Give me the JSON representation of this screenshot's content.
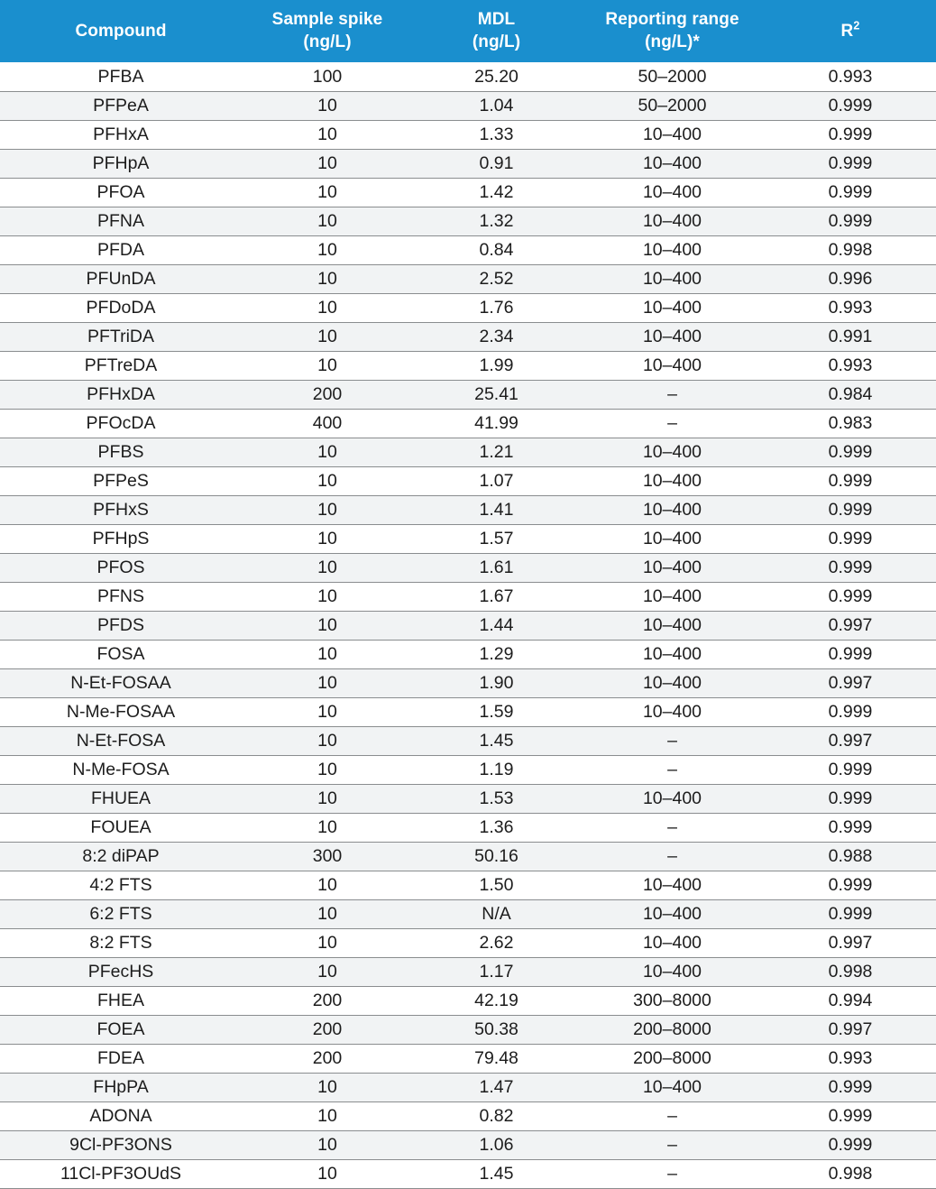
{
  "table": {
    "headers": [
      {
        "line1": "Compound",
        "line2": "",
        "key": "compound"
      },
      {
        "line1": "Sample spike",
        "line2": "(ng/L)",
        "key": "sample_spike"
      },
      {
        "line1": "MDL",
        "line2": "(ng/L)",
        "key": "mdl"
      },
      {
        "line1": "Reporting range",
        "line2": "(ng/L)*",
        "key": "reporting_range"
      },
      {
        "line1": "R",
        "line2": "",
        "sup": "2",
        "key": "r2"
      }
    ],
    "colors": {
      "header_background": "#1a8fce",
      "header_text": "#ffffff",
      "row_stripe": "#f1f3f4",
      "row_base": "#ffffff",
      "rule": "#8a8d8f",
      "body_text": "#1c1c1c"
    },
    "rows": [
      {
        "compound": "PFBA",
        "sample_spike": "100",
        "mdl": "25.20",
        "reporting_range": "50–2000",
        "r2": "0.993"
      },
      {
        "compound": "PFPeA",
        "sample_spike": "10",
        "mdl": "1.04",
        "reporting_range": "50–2000",
        "r2": "0.999"
      },
      {
        "compound": "PFHxA",
        "sample_spike": "10",
        "mdl": "1.33",
        "reporting_range": "10–400",
        "r2": "0.999"
      },
      {
        "compound": "PFHpA",
        "sample_spike": "10",
        "mdl": "0.91",
        "reporting_range": "10–400",
        "r2": "0.999"
      },
      {
        "compound": "PFOA",
        "sample_spike": "10",
        "mdl": "1.42",
        "reporting_range": "10–400",
        "r2": "0.999"
      },
      {
        "compound": "PFNA",
        "sample_spike": "10",
        "mdl": "1.32",
        "reporting_range": "10–400",
        "r2": "0.999"
      },
      {
        "compound": "PFDA",
        "sample_spike": "10",
        "mdl": "0.84",
        "reporting_range": "10–400",
        "r2": "0.998"
      },
      {
        "compound": "PFUnDA",
        "sample_spike": "10",
        "mdl": "2.52",
        "reporting_range": "10–400",
        "r2": "0.996"
      },
      {
        "compound": "PFDoDA",
        "sample_spike": "10",
        "mdl": "1.76",
        "reporting_range": "10–400",
        "r2": "0.993"
      },
      {
        "compound": "PFTriDA",
        "sample_spike": "10",
        "mdl": "2.34",
        "reporting_range": "10–400",
        "r2": "0.991"
      },
      {
        "compound": "PFTreDA",
        "sample_spike": "10",
        "mdl": "1.99",
        "reporting_range": "10–400",
        "r2": "0.993"
      },
      {
        "compound": "PFHxDA",
        "sample_spike": "200",
        "mdl": "25.41",
        "reporting_range": "–",
        "r2": "0.984"
      },
      {
        "compound": "PFOcDA",
        "sample_spike": "400",
        "mdl": "41.99",
        "reporting_range": "–",
        "r2": "0.983"
      },
      {
        "compound": "PFBS",
        "sample_spike": "10",
        "mdl": "1.21",
        "reporting_range": "10–400",
        "r2": "0.999"
      },
      {
        "compound": "PFPeS",
        "sample_spike": "10",
        "mdl": "1.07",
        "reporting_range": "10–400",
        "r2": "0.999"
      },
      {
        "compound": "PFHxS",
        "sample_spike": "10",
        "mdl": "1.41",
        "reporting_range": "10–400",
        "r2": "0.999"
      },
      {
        "compound": "PFHpS",
        "sample_spike": "10",
        "mdl": "1.57",
        "reporting_range": "10–400",
        "r2": "0.999"
      },
      {
        "compound": "PFOS",
        "sample_spike": "10",
        "mdl": "1.61",
        "reporting_range": "10–400",
        "r2": "0.999"
      },
      {
        "compound": "PFNS",
        "sample_spike": "10",
        "mdl": "1.67",
        "reporting_range": "10–400",
        "r2": "0.999"
      },
      {
        "compound": "PFDS",
        "sample_spike": "10",
        "mdl": "1.44",
        "reporting_range": "10–400",
        "r2": "0.997"
      },
      {
        "compound": "FOSA",
        "sample_spike": "10",
        "mdl": "1.29",
        "reporting_range": "10–400",
        "r2": "0.999"
      },
      {
        "compound": "N-Et-FOSAA",
        "sample_spike": "10",
        "mdl": "1.90",
        "reporting_range": "10–400",
        "r2": "0.997"
      },
      {
        "compound": "N-Me-FOSAA",
        "sample_spike": "10",
        "mdl": "1.59",
        "reporting_range": "10–400",
        "r2": "0.999"
      },
      {
        "compound": "N-Et-FOSA",
        "sample_spike": "10",
        "mdl": "1.45",
        "reporting_range": "–",
        "r2": "0.997"
      },
      {
        "compound": "N-Me-FOSA",
        "sample_spike": "10",
        "mdl": "1.19",
        "reporting_range": "–",
        "r2": "0.999"
      },
      {
        "compound": "FHUEA",
        "sample_spike": "10",
        "mdl": "1.53",
        "reporting_range": "10–400",
        "r2": "0.999"
      },
      {
        "compound": "FOUEA",
        "sample_spike": "10",
        "mdl": "1.36",
        "reporting_range": "–",
        "r2": "0.999"
      },
      {
        "compound": "8:2 diPAP",
        "sample_spike": "300",
        "mdl": "50.16",
        "reporting_range": "–",
        "r2": "0.988"
      },
      {
        "compound": "4:2 FTS",
        "sample_spike": "10",
        "mdl": "1.50",
        "reporting_range": "10–400",
        "r2": "0.999"
      },
      {
        "compound": "6:2 FTS",
        "sample_spike": "10",
        "mdl": "N/A",
        "reporting_range": "10–400",
        "r2": "0.999"
      },
      {
        "compound": "8:2 FTS",
        "sample_spike": "10",
        "mdl": "2.62",
        "reporting_range": "10–400",
        "r2": "0.997"
      },
      {
        "compound": "PFecHS",
        "sample_spike": "10",
        "mdl": "1.17",
        "reporting_range": "10–400",
        "r2": "0.998"
      },
      {
        "compound": "FHEA",
        "sample_spike": "200",
        "mdl": "42.19",
        "reporting_range": "300–8000",
        "r2": "0.994"
      },
      {
        "compound": "FOEA",
        "sample_spike": "200",
        "mdl": "50.38",
        "reporting_range": "200–8000",
        "r2": "0.997"
      },
      {
        "compound": "FDEA",
        "sample_spike": "200",
        "mdl": "79.48",
        "reporting_range": "200–8000",
        "r2": "0.993"
      },
      {
        "compound": "FHpPA",
        "sample_spike": "10",
        "mdl": "1.47",
        "reporting_range": "10–400",
        "r2": "0.999"
      },
      {
        "compound": "ADONA",
        "sample_spike": "10",
        "mdl": "0.82",
        "reporting_range": "–",
        "r2": "0.999"
      },
      {
        "compound": "9Cl-PF3ONS",
        "sample_spike": "10",
        "mdl": "1.06",
        "reporting_range": "–",
        "r2": "0.999"
      },
      {
        "compound": "11Cl-PF3OUdS",
        "sample_spike": "10",
        "mdl": "1.45",
        "reporting_range": "–",
        "r2": "0.998"
      }
    ]
  }
}
